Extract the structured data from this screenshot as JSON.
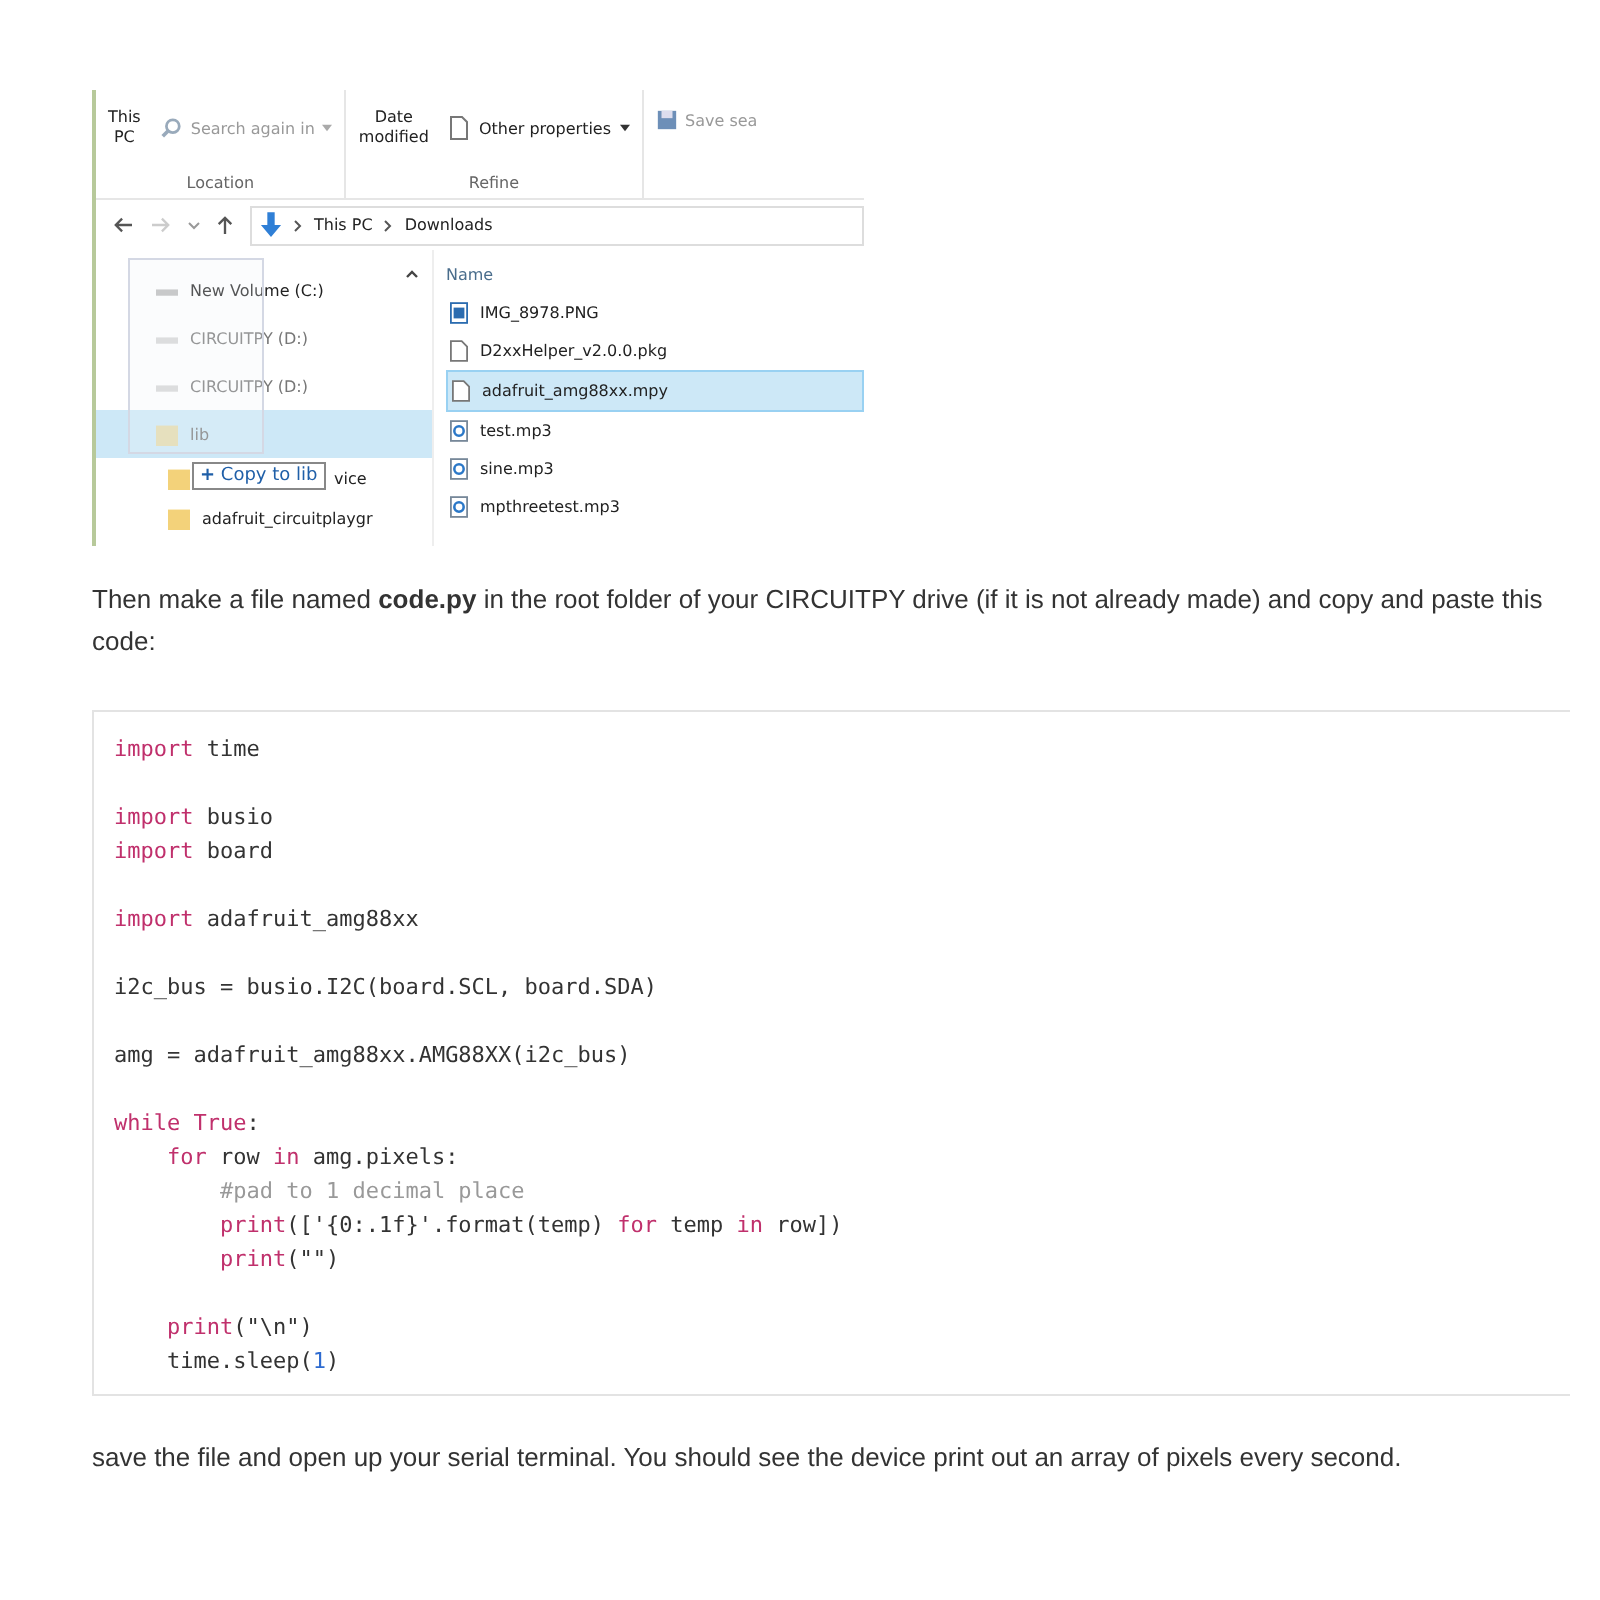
{
  "explorer": {
    "ribbon": [
      {
        "kind": "location",
        "lines": [
          "This",
          "PC"
        ],
        "action": "Search again in",
        "action_disabled": true,
        "group": "Location"
      },
      {
        "kind": "refine",
        "lines": [
          "Date",
          "modified"
        ],
        "action": "Other properties",
        "action_disabled": false,
        "group": "Refine"
      },
      {
        "kind": "save",
        "action": "Save sea",
        "action_disabled": true
      }
    ],
    "breadcrumb": [
      "This PC",
      "Downloads"
    ],
    "nav_items": [
      {
        "label": "New Volume (C:)",
        "kind": "drive",
        "selected": false,
        "faded": false
      },
      {
        "label": "CIRCUITPY (D:)",
        "kind": "drive",
        "selected": false,
        "faded": true
      },
      {
        "label": "CIRCUITPY (D:)",
        "kind": "drive",
        "selected": false,
        "faded": true
      },
      {
        "label": "lib",
        "kind": "folder",
        "selected": true,
        "faded": true
      },
      {
        "label": "vice",
        "kind": "folder",
        "selected": false,
        "faded": false,
        "drag_tooltip": {
          "symbol": "+",
          "label": "Copy to lib"
        }
      },
      {
        "label": "adafruit_circuitplaygr",
        "kind": "folder",
        "selected": false,
        "faded": false
      }
    ],
    "column_header": "Name",
    "files": [
      {
        "name": "IMG_8978.PNG",
        "kind": "image",
        "selected": false
      },
      {
        "name": "D2xxHelper_v2.0.0.pkg",
        "kind": "file",
        "selected": false
      },
      {
        "name": "adafruit_amg88xx.mpy",
        "kind": "file",
        "selected": true
      },
      {
        "name": "test.mp3",
        "kind": "audio",
        "selected": false
      },
      {
        "name": "sine.mp3",
        "kind": "audio",
        "selected": false
      },
      {
        "name": "mpthreetest.mp3",
        "kind": "audio",
        "selected": false
      }
    ]
  },
  "intro": "Then make a file named **code.py** in the root folder of your CIRCUITPY drive (if it is not already made) and copy and paste this code:",
  "code_blocks": [
    {
      "lines": [
        {
          "tokens": [
            {
              "kind": "keyword",
              "text": "import"
            },
            {
              "kind": "text",
              "text": " time"
            }
          ]
        }
      ]
    },
    {
      "lines": [
        {
          "tokens": [
            {
              "kind": "keyword",
              "text": "import"
            },
            {
              "kind": "text",
              "text": " busio"
            }
          ]
        },
        {
          "tokens": [
            {
              "kind": "keyword",
              "text": "import"
            },
            {
              "kind": "text",
              "text": " board"
            }
          ]
        }
      ]
    },
    {
      "lines": [
        {
          "tokens": [
            {
              "kind": "keyword",
              "text": "import"
            },
            {
              "kind": "text",
              "text": " adafruit_amg88xx"
            }
          ]
        }
      ]
    },
    {
      "lines": [
        {
          "tokens": [
            {
              "kind": "text",
              "text": "i2c_bus = busio.I2C(board.SCL, board.SDA)"
            }
          ]
        }
      ]
    },
    {
      "lines": [
        {
          "tokens": [
            {
              "kind": "text",
              "text": "amg = adafruit_amg88xx.AMG88XX(i2c_bus)"
            }
          ]
        }
      ]
    },
    {
      "lines": [
        {
          "tokens": [
            {
              "kind": "keyword",
              "text": "while True"
            },
            {
              "kind": "text",
              "text": ":"
            }
          ]
        },
        {
          "tokens": [
            {
              "kind": "keyword",
              "text": "    for"
            },
            {
              "kind": "text",
              "text": " row "
            },
            {
              "kind": "keyword",
              "text": "in"
            },
            {
              "kind": "text",
              "text": " amg.pixels:"
            }
          ]
        },
        {
          "tokens": [
            {
              "kind": "comment",
              "text": "        #pad to 1 decimal place"
            }
          ]
        },
        {
          "tokens": [
            {
              "kind": "keyword",
              "text": "        print"
            },
            {
              "kind": "text",
              "text": "(['{0:.1f}'.format(temp) "
            },
            {
              "kind": "keyword",
              "text": "for"
            },
            {
              "kind": "text",
              "text": " temp "
            },
            {
              "kind": "keyword",
              "text": "in"
            },
            {
              "kind": "text",
              "text": " row])"
            }
          ]
        },
        {
          "tokens": [
            {
              "kind": "keyword",
              "text": "        print"
            },
            {
              "kind": "text",
              "text": "(\"\")"
            }
          ]
        }
      ]
    },
    {
      "lines": [
        {
          "tokens": [
            {
              "kind": "keyword",
              "text": "    print"
            },
            {
              "kind": "text",
              "text": "(\"\\n\")"
            }
          ]
        },
        {
          "tokens": [
            {
              "kind": "text",
              "text": "    time.sleep("
            },
            {
              "kind": "number",
              "text": "1"
            },
            {
              "kind": "text",
              "text": ")"
            }
          ]
        }
      ]
    }
  ],
  "outro": "save the file and open up your serial terminal. You should see the device print out an array of pixels every second."
}
